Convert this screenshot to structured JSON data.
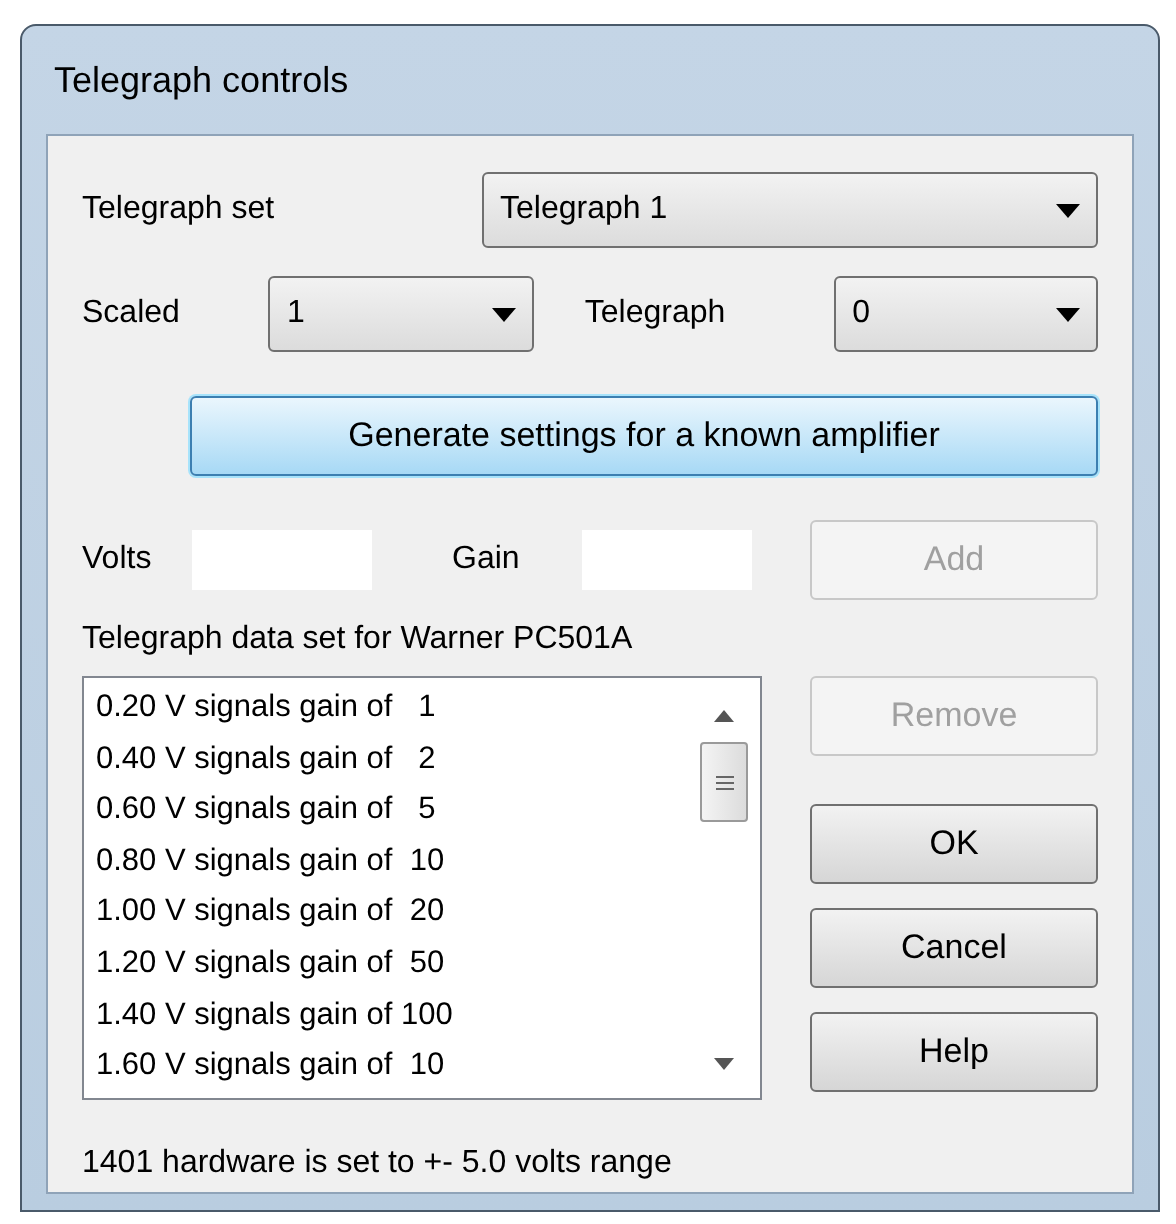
{
  "window": {
    "title": "Telegraph controls"
  },
  "telegraph_set": {
    "label": "Telegraph set",
    "value": "Telegraph 1"
  },
  "scaled": {
    "label": "Scaled",
    "value": "1"
  },
  "telegraph": {
    "label": "Telegraph",
    "value": "0"
  },
  "generate_button": {
    "label": "Generate settings for a known amplifier",
    "focused": true
  },
  "volts": {
    "label": "Volts"
  },
  "gain": {
    "label": "Gain"
  },
  "add_button": {
    "label": "Add",
    "disabled": true
  },
  "data_set_label": "Telegraph data set for Warner PC501A",
  "list_items": [
    "0.20 V signals gain of   1",
    "0.40 V signals gain of   2",
    "0.60 V signals gain of   5",
    "0.80 V signals gain of  10",
    "1.00 V signals gain of  20",
    "1.20 V signals gain of  50",
    "1.40 V signals gain of 100",
    "1.60 V signals gain of  10"
  ],
  "side_buttons": [
    {
      "label": "Remove",
      "disabled": true
    },
    {
      "label": "OK",
      "disabled": false
    },
    {
      "label": "Cancel",
      "disabled": false
    },
    {
      "label": "Help",
      "disabled": false
    }
  ],
  "status": "1401 hardware is set to +- 5.0 volts range"
}
